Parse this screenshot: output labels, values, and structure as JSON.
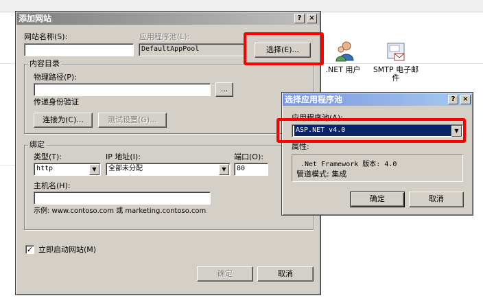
{
  "background": {
    "icons": [
      {
        "label": ".NET 用户",
        "icon": "users-icon"
      },
      {
        "label": "SMTP 电子邮件",
        "icon": "email-icon"
      }
    ]
  },
  "add_site": {
    "title": "添加网站",
    "help": "?",
    "close": "×",
    "site_name_label": "网站名称(S):",
    "site_name_value": "",
    "app_pool_label": "应用程序池(L):",
    "app_pool_value": "DefaultAppPool",
    "select_button": "选择(E)...",
    "content_group": "内容目录",
    "physical_path_label": "物理路径(P):",
    "physical_path_value": "",
    "browse_button": "...",
    "passthrough_label": "传递身份验证",
    "connect_as_button": "连接为(C)...",
    "test_settings_button": "测试设置(G)...",
    "binding_group": "绑定",
    "type_label": "类型(T):",
    "type_value": "http",
    "ip_label": "IP 地址(I):",
    "ip_value": "全部未分配",
    "port_label": "端口(O):",
    "port_value": "80",
    "hostname_label": "主机名(H):",
    "hostname_value": "",
    "example_text": "示例: www.contoso.com 或 marketing.contoso.com",
    "start_checkbox_label": "立即启动网站(M)",
    "start_checked": true,
    "ok_button": "确定",
    "cancel_button": "取消"
  },
  "select_pool": {
    "title": "选择应用程序池",
    "help": "?",
    "close": "×",
    "pool_label": "应用程序池(A):",
    "pool_value": "ASP.NET v4.0",
    "properties_label": "属性:",
    "framework_line": ".Net Framework 版本: 4.0",
    "pipeline_line": "管道模式: 集成",
    "ok_button": "确定",
    "cancel_button": "取消"
  },
  "colors": {
    "highlight": "#ff0000",
    "selection": "#0a246a",
    "dialog_face": "#d4d0c8"
  }
}
